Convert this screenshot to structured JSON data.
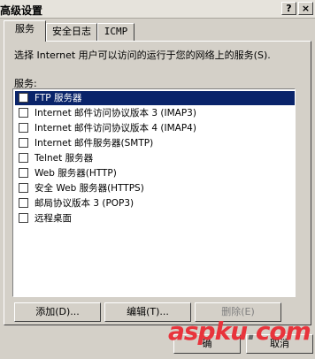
{
  "window": {
    "title": "高级设置",
    "help_symbol": "?",
    "close_symbol": "×"
  },
  "tabs": [
    {
      "label": "服务",
      "active": true
    },
    {
      "label": "安全日志",
      "active": false
    },
    {
      "label": "ICMP",
      "active": false
    }
  ],
  "description": "选择 Internet 用户可以访问的运行于您的网络上的服务(S).",
  "services_label": "服务:",
  "services": [
    {
      "label": "FTP 服务器",
      "checked": false,
      "selected": true
    },
    {
      "label": "Internet 邮件访问协议版本 3 (IMAP3)",
      "checked": false,
      "selected": false
    },
    {
      "label": "Internet 邮件访问协议版本 4 (IMAP4)",
      "checked": false,
      "selected": false
    },
    {
      "label": "Internet 邮件服务器(SMTP)",
      "checked": false,
      "selected": false
    },
    {
      "label": "Telnet 服务器",
      "checked": false,
      "selected": false
    },
    {
      "label": "Web 服务器(HTTP)",
      "checked": false,
      "selected": false
    },
    {
      "label": "安全 Web 服务器(HTTPS)",
      "checked": false,
      "selected": false
    },
    {
      "label": "邮局协议版本 3 (POP3)",
      "checked": false,
      "selected": false
    },
    {
      "label": "远程桌面",
      "checked": false,
      "selected": false
    }
  ],
  "buttons": {
    "add": "添加(D)...",
    "edit": "编辑(T)...",
    "delete": "删除(E)",
    "ok": "确",
    "cancel": "取消"
  },
  "watermark": {
    "brand": "aspku",
    "dot": ".",
    "tld": "com"
  }
}
